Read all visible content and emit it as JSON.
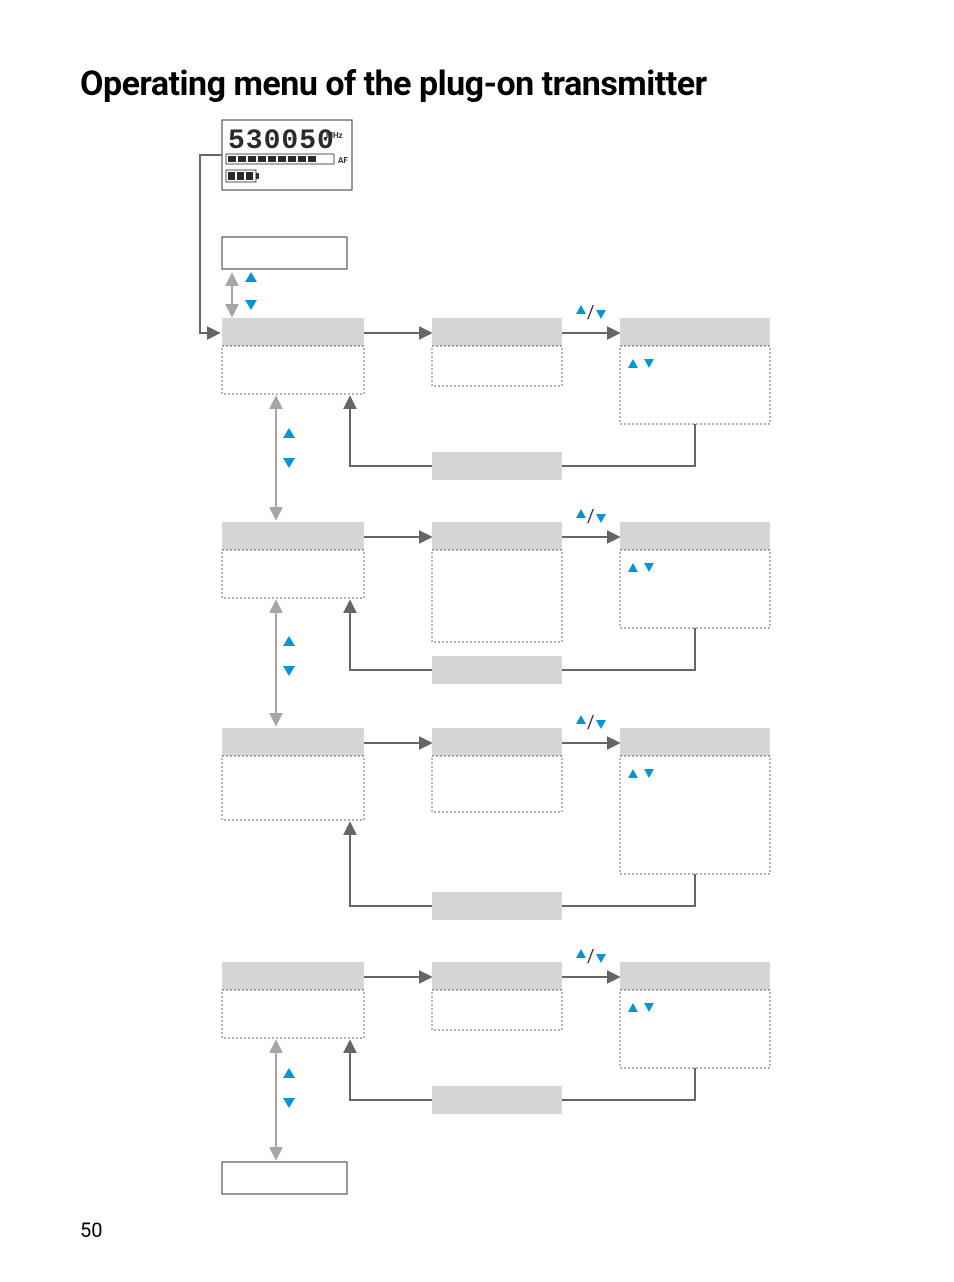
{
  "title": "Operating menu of the plug-on transmitter",
  "page_number": "50",
  "lcd": {
    "freq": "530050",
    "unit": "MHz",
    "af_label": "AF"
  },
  "colors": {
    "accent": "#0095d6",
    "panel": "#d6d6d6",
    "stroke_dark": "#666666",
    "stroke_light": "#a6a6a6"
  }
}
